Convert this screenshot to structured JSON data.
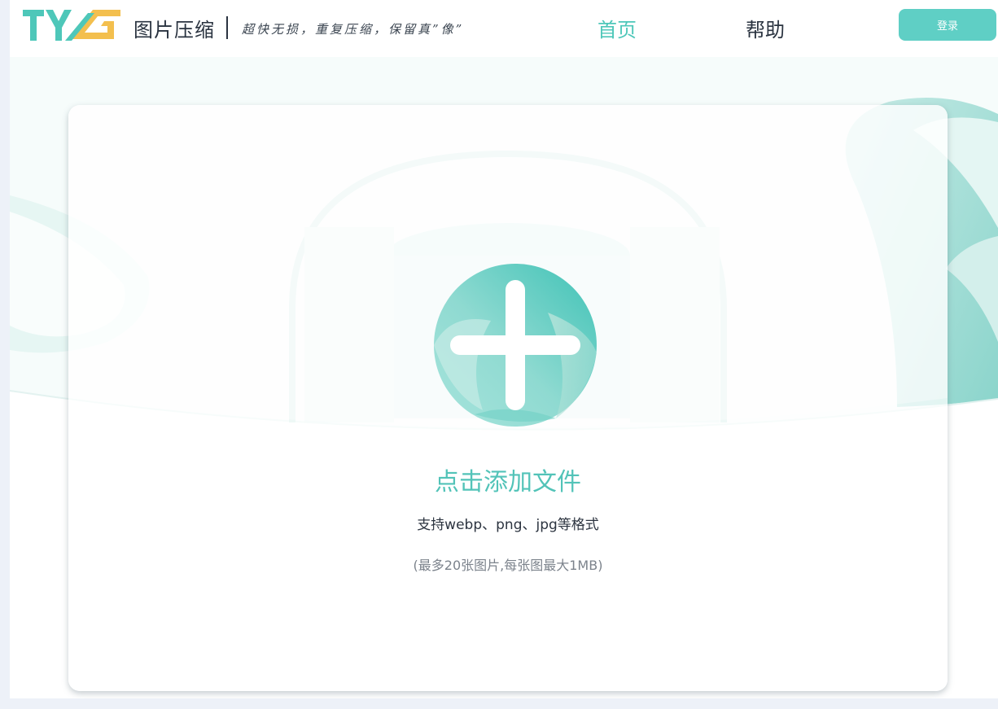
{
  "header": {
    "logo_text": "TYG",
    "site_name": "图片压缩",
    "slogan": "超快无损，重复压缩，保留真”像”",
    "nav": {
      "home": "首页",
      "help": "帮助"
    },
    "login_label": "登录"
  },
  "upload": {
    "title": "点击添加文件",
    "formats": "支持webp、png、jpg等格式",
    "limit": "(最多20张图片,每张图最大1MB)"
  },
  "colors": {
    "accent": "#52c3b8",
    "button": "#5fcfc5",
    "logo_yellow": "#f3bf4e",
    "text": "#2a3340"
  }
}
